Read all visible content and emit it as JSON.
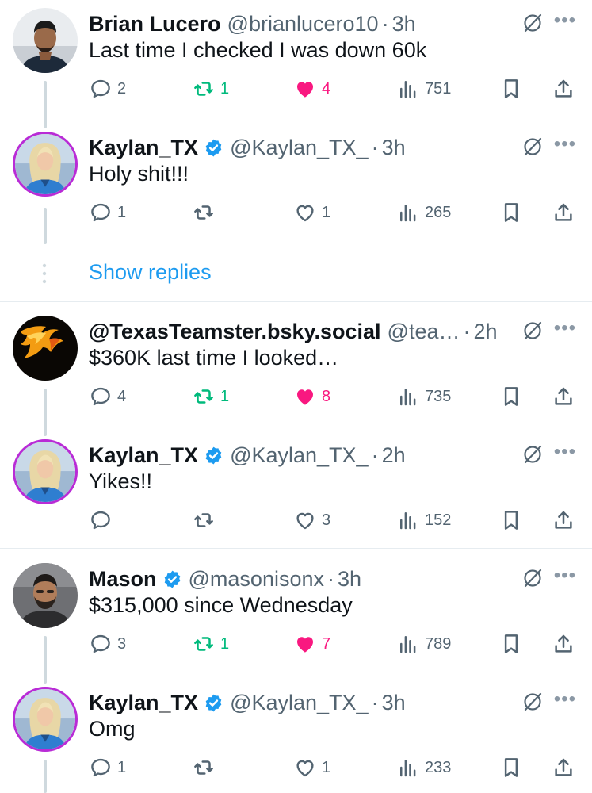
{
  "tweets": [
    {
      "name": "Brian Lucero",
      "verified": false,
      "handle": "@brianlucero10",
      "time": "3h",
      "text": "Last time I checked I was down 60k",
      "replies": "2",
      "reposts": "1",
      "likes": "4",
      "views": "751",
      "liked": true,
      "reposted": true,
      "avatar": "profile-photo-man"
    },
    {
      "name": "Kaylan_TX",
      "verified": true,
      "handle": "@Kaylan_TX_",
      "time": "3h",
      "text": "Holy shit!!!",
      "replies": "1",
      "reposts": "",
      "likes": "1",
      "views": "265",
      "liked": false,
      "reposted": false,
      "avatar": "profile-photo-woman"
    },
    {
      "name": "@TexasTeamster.bsky.social",
      "verified": false,
      "handle": "@tea…",
      "time": "2h",
      "text": "$360K last time I looked…",
      "replies": "4",
      "reposts": "1",
      "likes": "8",
      "views": "735",
      "liked": true,
      "reposted": true,
      "avatar": "flaming-horse-logo"
    },
    {
      "name": "Kaylan_TX",
      "verified": true,
      "handle": "@Kaylan_TX_",
      "time": "2h",
      "text": "Yikes!!",
      "replies": "",
      "reposts": "",
      "likes": "3",
      "views": "152",
      "liked": false,
      "reposted": false,
      "avatar": "profile-photo-woman"
    },
    {
      "name": "Mason",
      "verified": true,
      "handle": "@masonisonx",
      "time": "3h",
      "text": "$315,000 since Wednesday",
      "replies": "3",
      "reposts": "1",
      "likes": "7",
      "views": "789",
      "liked": true,
      "reposted": true,
      "avatar": "profile-photo-man-bearded"
    },
    {
      "name": "Kaylan_TX",
      "verified": true,
      "handle": "@Kaylan_TX_",
      "time": "3h",
      "text": "Omg",
      "replies": "1",
      "reposts": "",
      "likes": "1",
      "views": "233",
      "liked": false,
      "reposted": false,
      "avatar": "profile-photo-woman"
    }
  ],
  "show_replies_label": "Show replies",
  "separator": "·",
  "more_glyph": "•••",
  "colors": {
    "link_blue": "#1d9bf0",
    "like_pink": "#f91880",
    "repost_green": "#00ba7c",
    "muted_gray": "#536471",
    "avatar_ring": "#b92bd6"
  }
}
